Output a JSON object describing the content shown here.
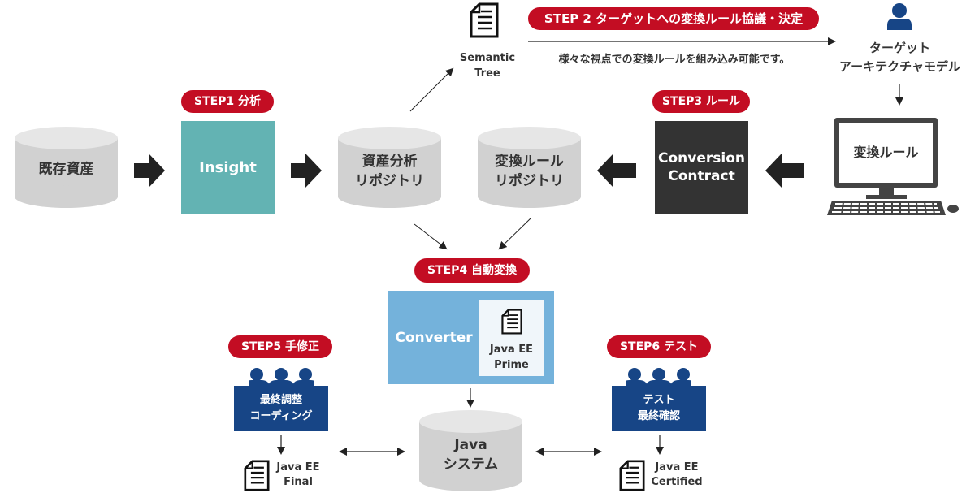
{
  "steps": {
    "step1": "STEP1 分析",
    "step2": "STEP 2  ターゲットへの変換ルール協議・決定",
    "step3": "STEP3 ルール",
    "step4": "STEP4 自動変換",
    "step5": "STEP5 手修正",
    "step6": "STEP6 テスト"
  },
  "step2_note": "様々な視点での変換ルールを組み込み可能です。",
  "semantic_tree": {
    "line1": "Semantic",
    "line2": "Tree"
  },
  "target_model": {
    "line1": "ターゲット",
    "line2": "アーキテクチャモデル"
  },
  "existing_assets": "既存資産",
  "insight": "Insight",
  "asset_repo": {
    "line1": "資産分析",
    "line2": "リポジトリ"
  },
  "rule_repo": {
    "line1": "変換ルール",
    "line2": "リポジトリ"
  },
  "conversion_contract": {
    "line1": "Conversion",
    "line2": "Contract"
  },
  "monitor_label": "変換ルール",
  "converter": {
    "label": "Converter",
    "doc_line1": "Java EE",
    "doc_line2": "Prime"
  },
  "team_manual": {
    "line1": "最終調整",
    "line2": "コーディング"
  },
  "team_test": {
    "line1": "テスト",
    "line2": "最終確認"
  },
  "java_final": {
    "line1": "Java EE",
    "line2": "Final"
  },
  "java_certified": {
    "line1": "Java EE",
    "line2": "Certified"
  },
  "java_system": {
    "line1": "Java",
    "line2": "システム"
  },
  "colors": {
    "step_red": "#c30d23",
    "insight_teal": "#63b3b3",
    "contract_dark": "#333333",
    "converter_blue": "#74b2db",
    "team_navy": "#174586",
    "cylinder_gray": "#d1d1d1"
  }
}
